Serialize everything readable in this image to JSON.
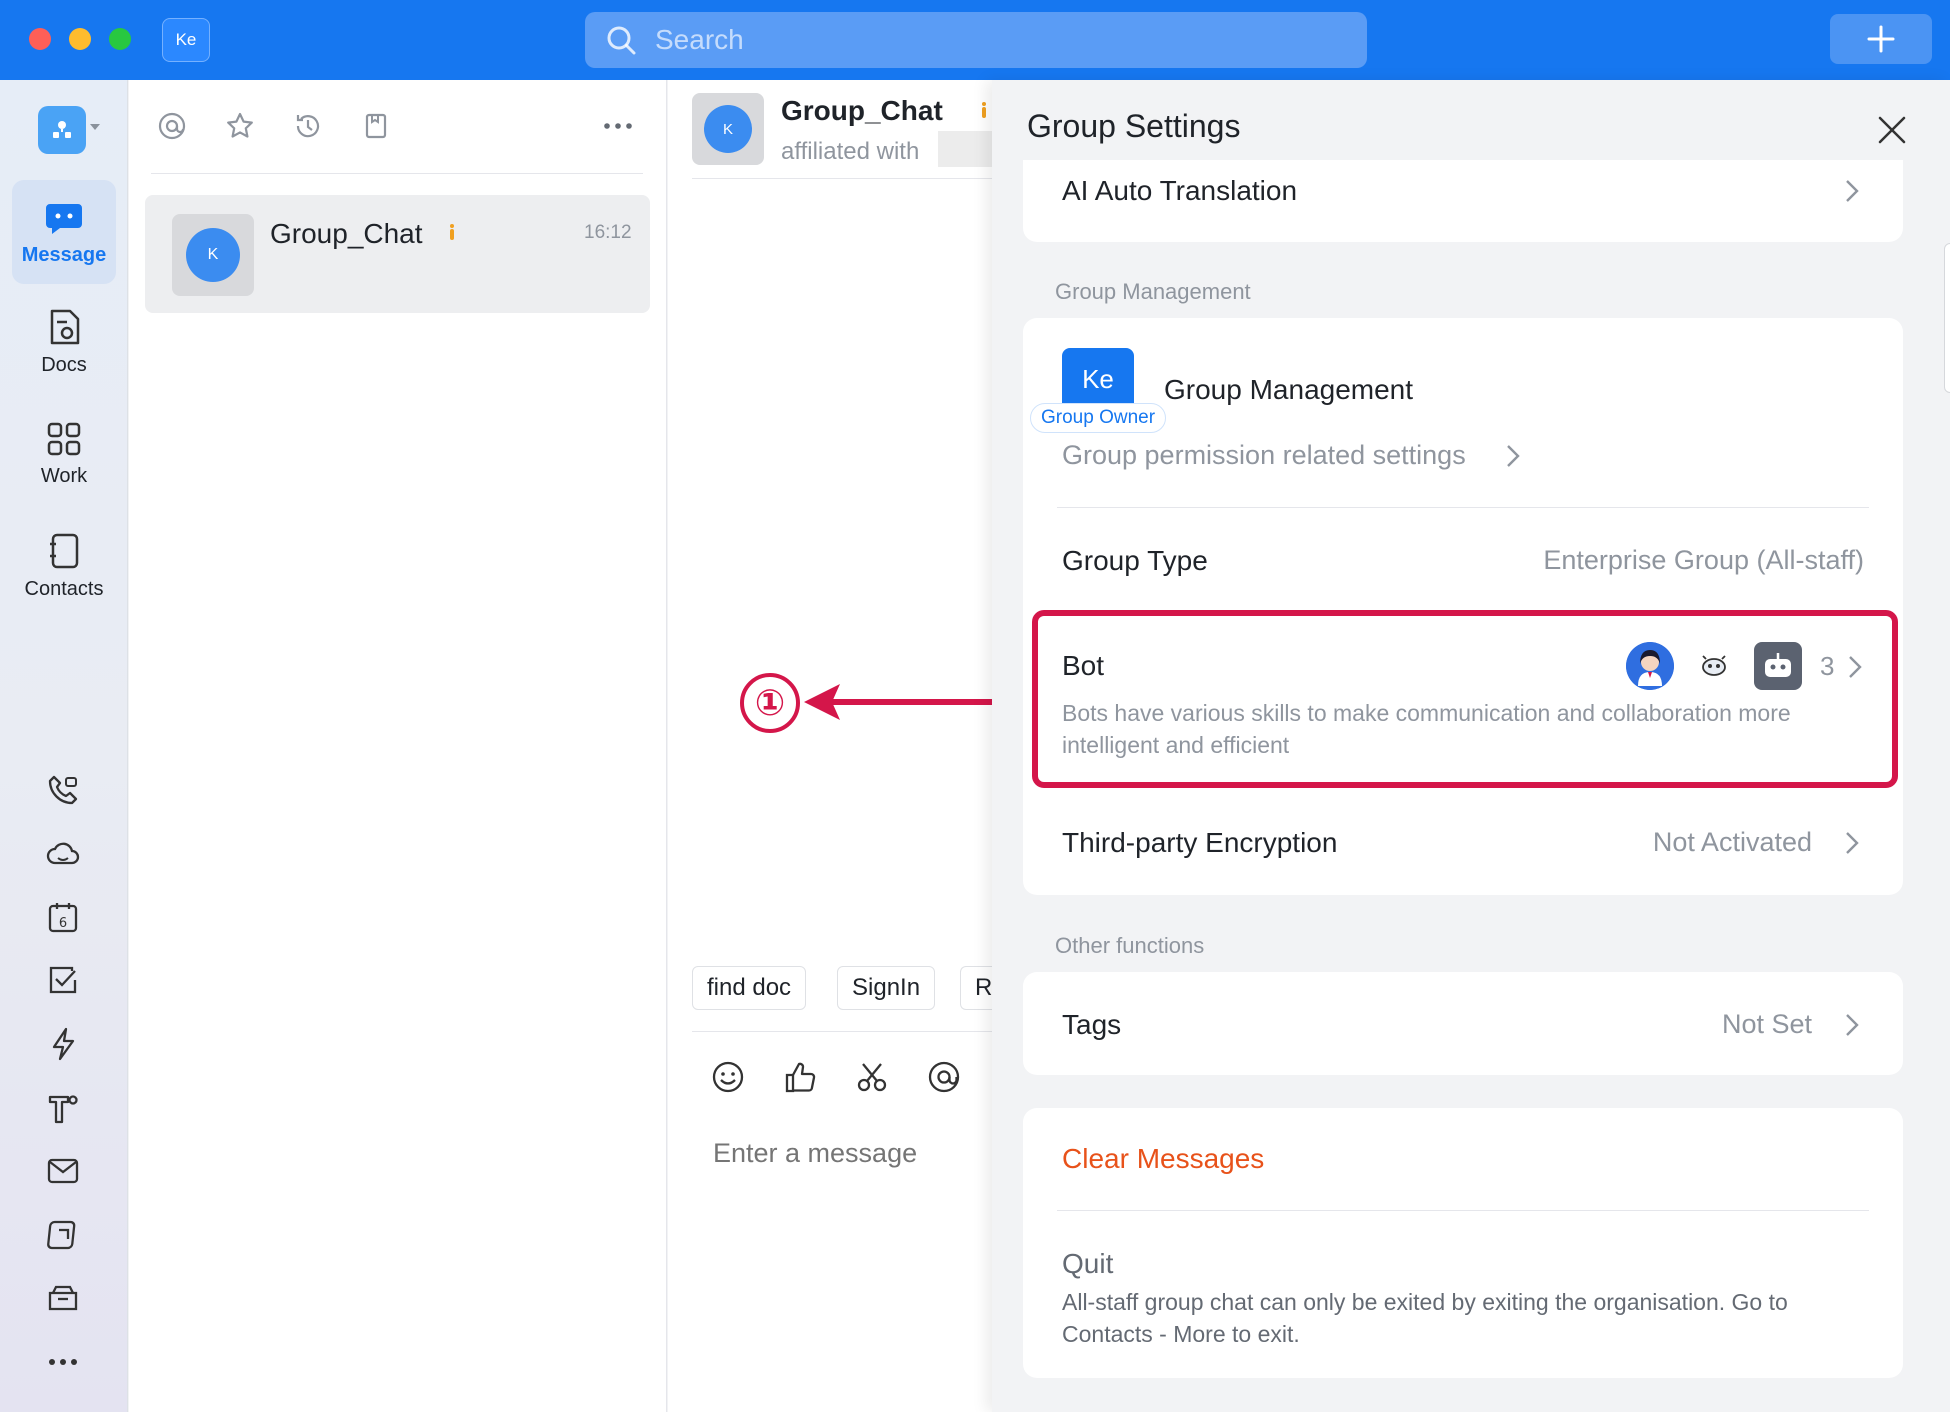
{
  "titlebar": {
    "app_badge": "Ke",
    "search_placeholder": "Search"
  },
  "nav": {
    "items": [
      {
        "label": "Message",
        "icon": "message-icon",
        "active": true
      },
      {
        "label": "Docs",
        "icon": "docs-icon"
      },
      {
        "label": "Work",
        "icon": "work-grid-icon"
      },
      {
        "label": "Contacts",
        "icon": "contacts-icon"
      }
    ],
    "tools": [
      "phone-icon",
      "cloud-icon",
      "calendar-icon",
      "task-check-icon",
      "lightning-icon",
      "text-format-icon",
      "mail-icon",
      "note-icon",
      "archive-icon",
      "more-icon"
    ],
    "calendar_day": "6"
  },
  "chat_list": {
    "toolbar": [
      "at-mention-icon",
      "star-icon",
      "history-icon",
      "bookmark-icon",
      "more-icon"
    ],
    "items": [
      {
        "name": "Group_Chat",
        "time": "16:12",
        "avatar": "K"
      }
    ]
  },
  "chat": {
    "avatar": "K",
    "name": "Group_Chat",
    "subtitle": "affiliated with",
    "quick_replies": [
      "find doc",
      "SignIn",
      "R"
    ],
    "composer_icons": [
      "emoji-icon",
      "thumbs-up-icon",
      "scissors-icon",
      "at-icon"
    ],
    "input_placeholder": "Enter a message"
  },
  "annotation": {
    "number": "①",
    "color": "#d4164a"
  },
  "panel": {
    "title": "Group Settings",
    "ai_translation": "AI Auto Translation",
    "group_management_section": "Group Management",
    "management": {
      "avatar_text": "Ke",
      "owner_tag": "Group Owner",
      "title": "Group Management",
      "subtitle": "Group permission related settings"
    },
    "group_type": {
      "label": "Group Type",
      "value": "Enterprise Group (All-staff)"
    },
    "bot": {
      "label": "Bot",
      "count": "3",
      "description": "Bots have various skills to make communication and collaboration more intelligent and efficient"
    },
    "encryption": {
      "label": "Third-party Encryption",
      "value": "Not Activated"
    },
    "other_section": "Other functions",
    "tags": {
      "label": "Tags",
      "value": "Not Set"
    },
    "clear_messages": "Clear Messages",
    "quit": {
      "label": "Quit",
      "description": "All-staff group chat can only be exited by exiting the organisation. Go to Contacts - More to exit."
    }
  },
  "colors": {
    "brand_blue": "#1677f0",
    "danger_orange": "#e8521a",
    "highlight_red": "#d4164a"
  }
}
